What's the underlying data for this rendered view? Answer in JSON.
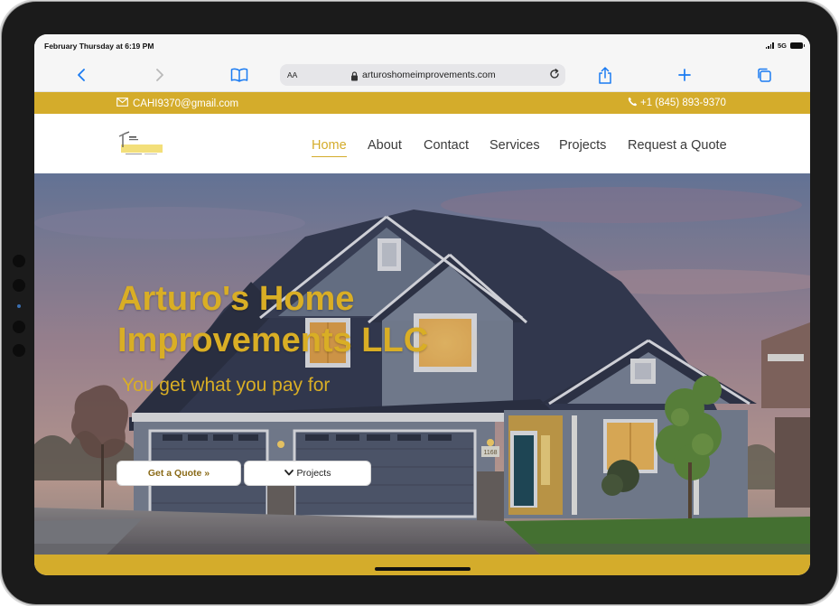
{
  "status_bar": {
    "time": "February Thursday at 6:19 PM",
    "network": "5G"
  },
  "browser": {
    "text_size_label": "AA",
    "url": "arturoshomeimprovements.com",
    "icons": [
      "back-icon",
      "forward-icon",
      "bookmarks-icon",
      "lock-icon",
      "reload-icon",
      "share-icon",
      "new-tab-icon",
      "tabs-icon"
    ]
  },
  "infobar": {
    "email": "CAHI9370@gmail.com",
    "phone": "+1 (845) 893-9370"
  },
  "nav": {
    "items": [
      {
        "label": "Home",
        "active": true
      },
      {
        "label": "About",
        "active": false
      },
      {
        "label": "Contact",
        "active": false
      },
      {
        "label": "Services",
        "active": false
      },
      {
        "label": "Projects",
        "active": false
      },
      {
        "label": "Request a Quote",
        "active": false
      }
    ]
  },
  "hero": {
    "title_line1": "Arturo's Home",
    "title_line2": "Improvements LLC",
    "subtitle": "You get  what you pay for",
    "quote_button": "Get a Quote »",
    "projects_button": "Projects",
    "house_number": "1168"
  },
  "colors": {
    "brand_gold": "#d4ac2b",
    "hero_text": "#d9ae25",
    "nav_text": "#3a3a3a",
    "safari_blue": "#1a7bf2"
  }
}
